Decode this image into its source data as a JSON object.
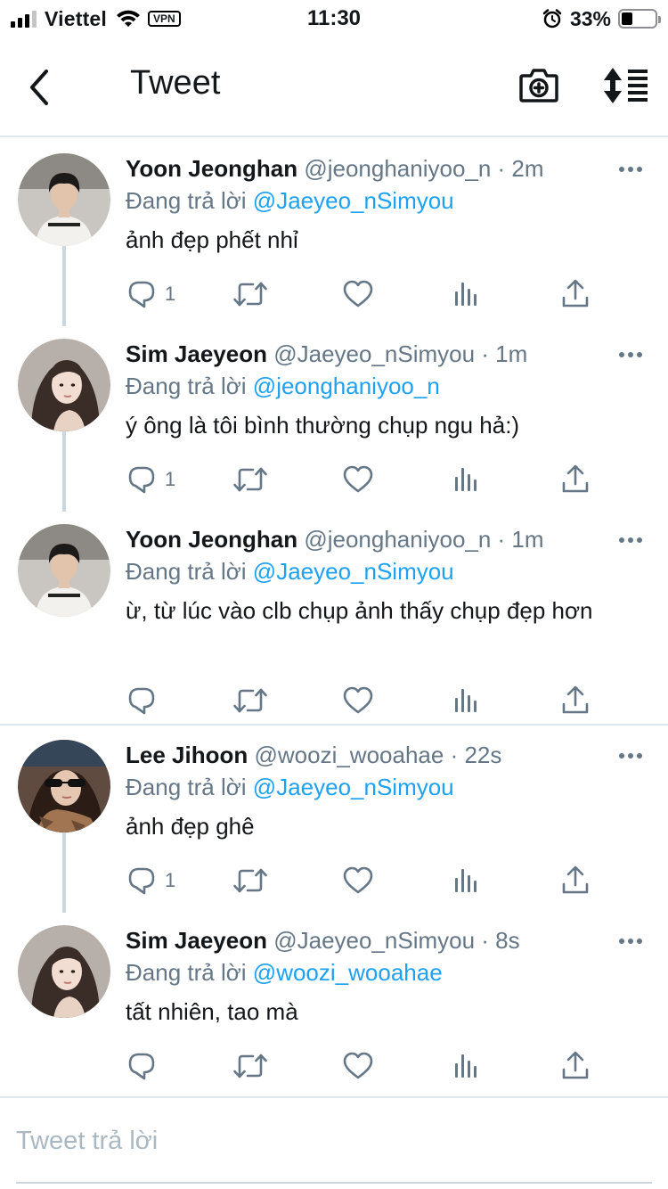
{
  "status_bar": {
    "carrier": "Viettel",
    "vpn": "VPN",
    "time": "11:30",
    "battery_percent": "33%",
    "battery_level": 0.33,
    "signal_bars": 3
  },
  "nav": {
    "title": "Tweet"
  },
  "colors": {
    "link": "#1da1f2",
    "secondary_text": "#657786",
    "divider": "#e1e8ed"
  },
  "tweets": [
    {
      "name": "Yoon Jeonghan",
      "meta": "@jeonghaniyoo_n · 2m",
      "reply_prefix": "Đang trả lời",
      "reply_to": "@Jaeyeo_nSimyou",
      "text": "ảnh đẹp phết nhỉ",
      "reply_count": "1"
    },
    {
      "name": "Sim Jaeyeon",
      "meta": "@Jaeyeo_nSimyou · 1m",
      "reply_prefix": "Đang trả lời",
      "reply_to": "@jeonghaniyoo_n",
      "text": "ý ông là tôi bình thường chụp ngu hả:)",
      "reply_count": "1"
    },
    {
      "name": "Yoon Jeonghan",
      "meta": "@jeonghaniyoo_n · 1m",
      "reply_prefix": "Đang trả lời",
      "reply_to": "@Jaeyeo_nSimyou",
      "text": "ừ, từ lúc vào clb chụp ảnh thấy chụp đẹp hơn",
      "reply_count": ""
    },
    {
      "name": "Lee Jihoon",
      "meta": "@woozi_wooahae · 22s",
      "reply_prefix": "Đang trả lời",
      "reply_to": "@Jaeyeo_nSimyou",
      "text": "ảnh đẹp ghê",
      "reply_count": "1"
    },
    {
      "name": "Sim Jaeyeon",
      "meta": "@Jaeyeo_nSimyou · 8s",
      "reply_prefix": "Đang trả lời",
      "reply_to": "@woozi_wooahae",
      "text": "tất nhiên, tao mà",
      "reply_count": ""
    }
  ],
  "composer": {
    "placeholder": "Tweet trả lời"
  }
}
